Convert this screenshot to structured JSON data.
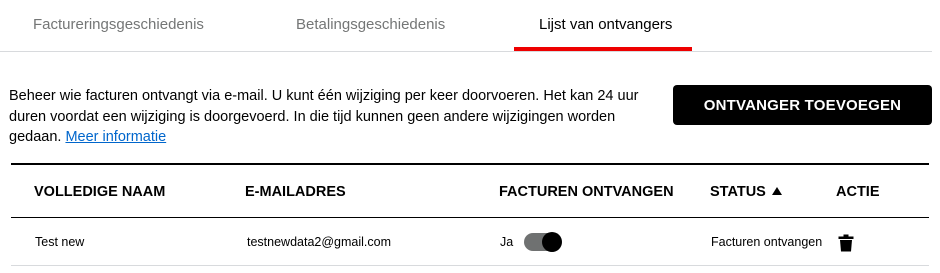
{
  "tabs": [
    {
      "label": "Factureringsgeschiedenis",
      "active": false
    },
    {
      "label": "Betalingsgeschiedenis",
      "active": false
    },
    {
      "label": "Lijst van ontvangers",
      "active": true
    }
  ],
  "accent_color": "#ee0000",
  "description": {
    "text": "Beheer wie facturen ontvangt via e-mail. U kunt één wijziging per keer doorvoeren. Het kan 24 uur duren voordat een wijziging is doorgevoerd. In die tijd kunnen geen andere wijzigingen worden gedaan. ",
    "link": "Meer informatie"
  },
  "add_button_label": "ONTVANGER TOEVOEGEN",
  "table": {
    "columns": [
      "VOLLEDIGE NAAM",
      "E-MAILADRES",
      "FACTUREN ONTVANGEN",
      "STATUS",
      "ACTIE"
    ],
    "sort": {
      "column": "STATUS",
      "direction": "ascending",
      "icon": "sort-up-icon"
    },
    "rows": [
      {
        "name": "Test new",
        "email": "testnewdata2@gmail.com",
        "receive_label": "Ja",
        "receive_on": true,
        "status": "Facturen ontvangen",
        "action_icon": "trash-icon"
      }
    ]
  }
}
